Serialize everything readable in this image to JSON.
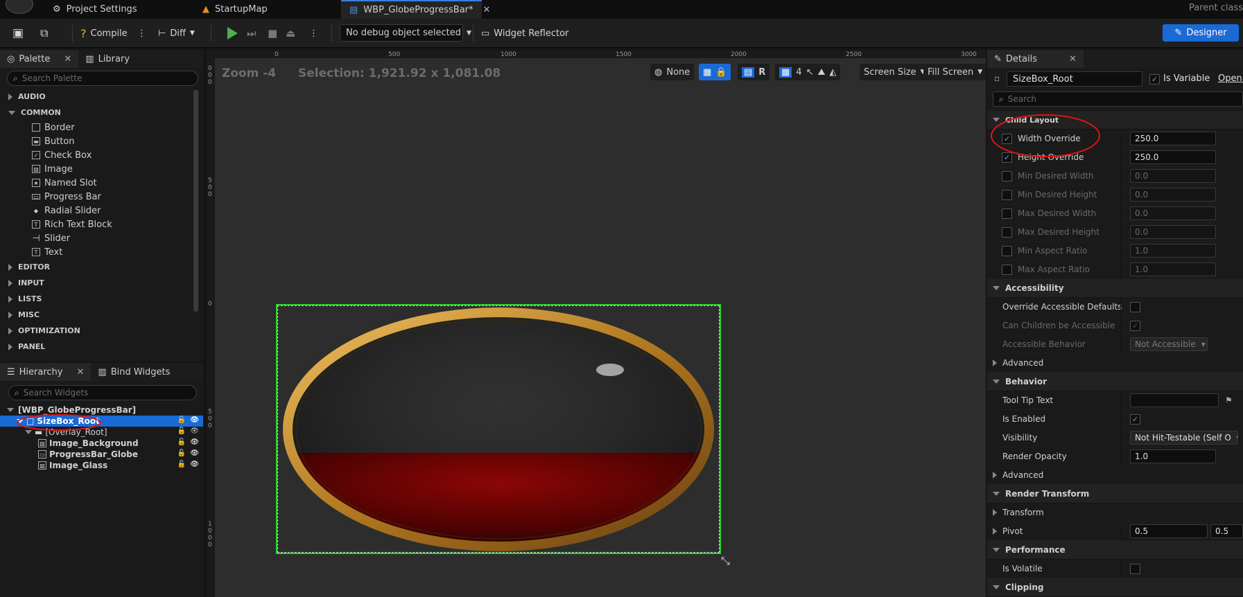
{
  "tabs": {
    "project_settings": "Project Settings",
    "startup_map": "StartupMap",
    "widget": "WBP_GlobeProgressBar*",
    "parent_class": "Parent class"
  },
  "toolbar": {
    "compile": "Compile",
    "diff": "Diff",
    "debug_object": "No debug object selected",
    "widget_reflector": "Widget Reflector",
    "designer": "Designer"
  },
  "palette": {
    "tab_label": "Palette",
    "library_label": "Library",
    "search_placeholder": "Search Palette",
    "categories": [
      "AUDIO",
      "COMMON",
      "EDITOR",
      "INPUT",
      "LISTS",
      "MISC",
      "OPTIMIZATION",
      "PANEL"
    ],
    "common_items": [
      "Border",
      "Button",
      "Check Box",
      "Image",
      "Named Slot",
      "Progress Bar",
      "Radial Slider",
      "Rich Text Block",
      "Slider",
      "Text"
    ]
  },
  "hierarchy": {
    "tab_label": "Hierarchy",
    "bind_label": "Bind Widgets",
    "search_placeholder": "Search Widgets",
    "root": "[WBP_GlobeProgressBar]",
    "items": [
      "SizeBox_Root",
      "[Overlay_Root]",
      "Image_Background",
      "ProgressBar_Globe",
      "Image_Glass"
    ]
  },
  "viewport": {
    "zoom": "Zoom -4",
    "selection": "Selection: 1,921.92 x 1,081.08",
    "none_label": "None",
    "r_label": "R",
    "grid_count": "4",
    "screen_size": "Screen Size",
    "fill_screen": "Fill Screen",
    "ruler_h": [
      "0",
      "500",
      "1000",
      "1500",
      "2000",
      "2500",
      "3000"
    ],
    "ruler_v_top": "0 0 0",
    "ruler_v_500": "5 0 0",
    "ruler_v_0": "0",
    "ruler_v_mid": "5 0 0",
    "ruler_v_1000": "1 0 0 0",
    "progress_percent": 40,
    "frame_color": "#2fd52f"
  },
  "details": {
    "tab_label": "Details",
    "name": "SizeBox_Root",
    "is_variable": "Is Variable",
    "open": "Open S",
    "search_placeholder": "Search",
    "child_layout": "Child Layout",
    "width_override": "Width Override",
    "width_value": "250.0",
    "height_override": "Height Override",
    "height_value": "250.0",
    "min_desired_width": "Min Desired Width",
    "min_desired_width_value": "0.0",
    "min_desired_height": "Min Desired Height",
    "min_desired_height_value": "0.0",
    "max_desired_width": "Max Desired Width",
    "max_desired_width_value": "0.0",
    "max_desired_height": "Max Desired Height",
    "max_desired_height_value": "0.0",
    "min_aspect_ratio": "Min Aspect Ratio",
    "min_aspect_ratio_value": "1.0",
    "max_aspect_ratio": "Max Aspect Ratio",
    "max_aspect_ratio_value": "1.0",
    "accessibility": "Accessibility",
    "override_accessible": "Override Accessible Defaults",
    "can_children": "Can Children be Accessible",
    "accessible_behavior": "Accessible Behavior",
    "accessible_behavior_value": "Not Accessible",
    "advanced": "Advanced",
    "behavior": "Behavior",
    "tooltip": "Tool Tip Text",
    "is_enabled": "Is Enabled",
    "visibility": "Visibility",
    "visibility_value": "Not Hit-Testable (Self O",
    "render_opacity": "Render Opacity",
    "render_opacity_value": "1.0",
    "advanced2": "Advanced",
    "render_transform": "Render Transform",
    "transform": "Transform",
    "pivot": "Pivot",
    "pivot_x": "0.5",
    "pivot_y": "0.5",
    "performance": "Performance",
    "is_volatile": "Is Volatile",
    "clipping": "Clipping"
  },
  "colors": {
    "accent": "#1a6ad6",
    "selection": "#1a6ad6",
    "annotation": "#e01414"
  }
}
